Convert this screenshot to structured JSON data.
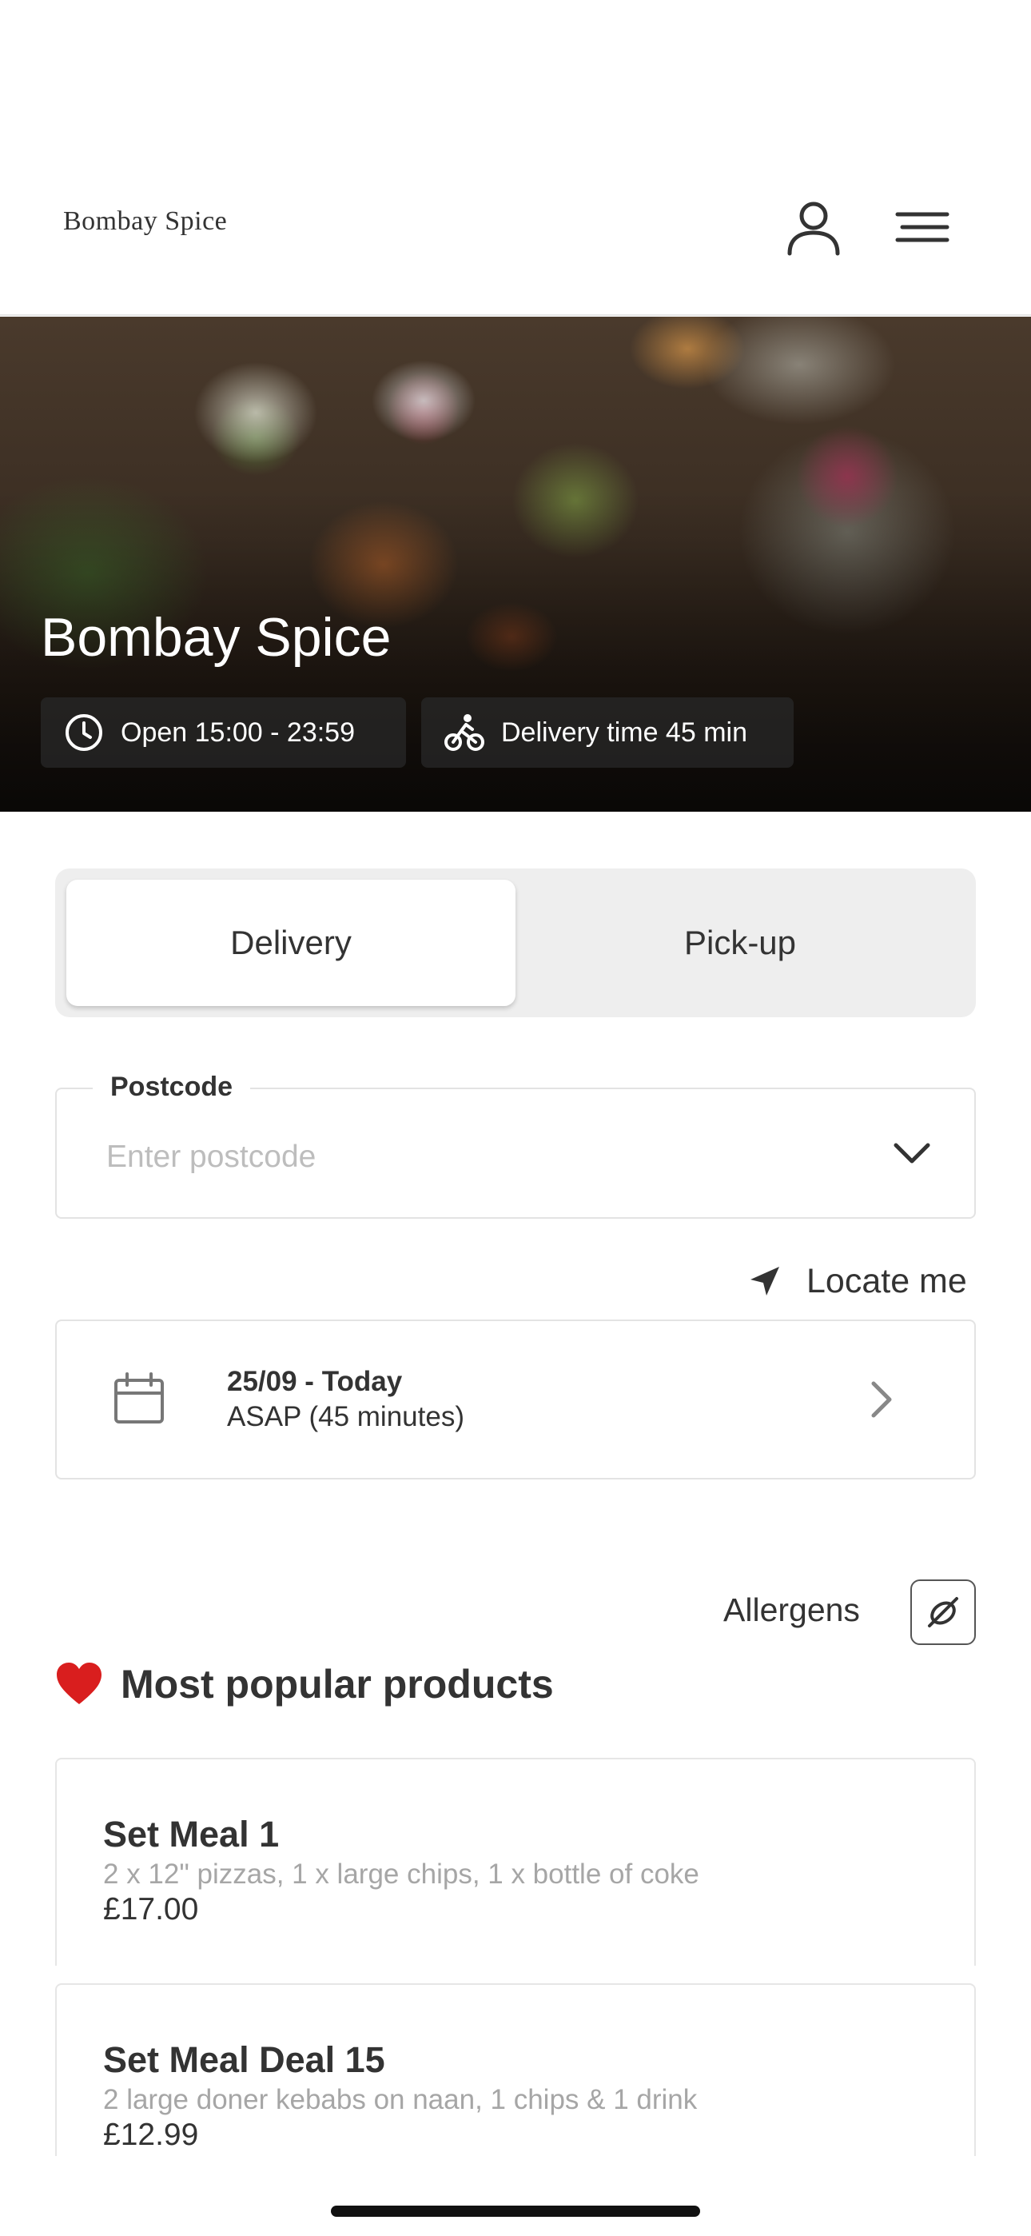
{
  "header": {
    "logo": "Bombay Spice",
    "icons": {
      "account": "user-icon",
      "menu": "hamburger-menu-icon"
    }
  },
  "hero": {
    "title": "Bombay Spice",
    "open_hours": "Open 15:00 - 23:59",
    "delivery_time": "Delivery time 45 min",
    "icons": {
      "open": "clock-icon",
      "delivery": "cyclist-icon"
    }
  },
  "order_type": {
    "options": [
      "Delivery",
      "Pick-up"
    ],
    "selected": "Delivery"
  },
  "postcode": {
    "label": "Postcode",
    "placeholder": "Enter postcode",
    "value": ""
  },
  "locate": {
    "label": "Locate me",
    "icon": "location-arrow-icon"
  },
  "schedule": {
    "date": "25/09 - Today",
    "time": "ASAP (45 minutes)",
    "icon": "calendar-icon"
  },
  "allergens": {
    "label": "Allergens",
    "icon": "allergen-filter-icon"
  },
  "popular": {
    "title": "Most popular products",
    "icon": "heart-icon",
    "products": [
      {
        "name": "Set Meal 1",
        "description": "2 x 12\" pizzas, 1 x large chips, 1 x bottle of coke",
        "price": "£17.00"
      },
      {
        "name": "Set Meal Deal 15",
        "description": "2 large doner kebabs on naan, 1 chips & 1 drink",
        "price": "£12.99"
      }
    ]
  },
  "colors": {
    "text": "#333333",
    "muted": "#a6a6a6",
    "placeholder": "#bdbdbd",
    "border": "#e3e3e3",
    "toggle_bg": "#eeeeee",
    "heart": "#d91e1e"
  }
}
